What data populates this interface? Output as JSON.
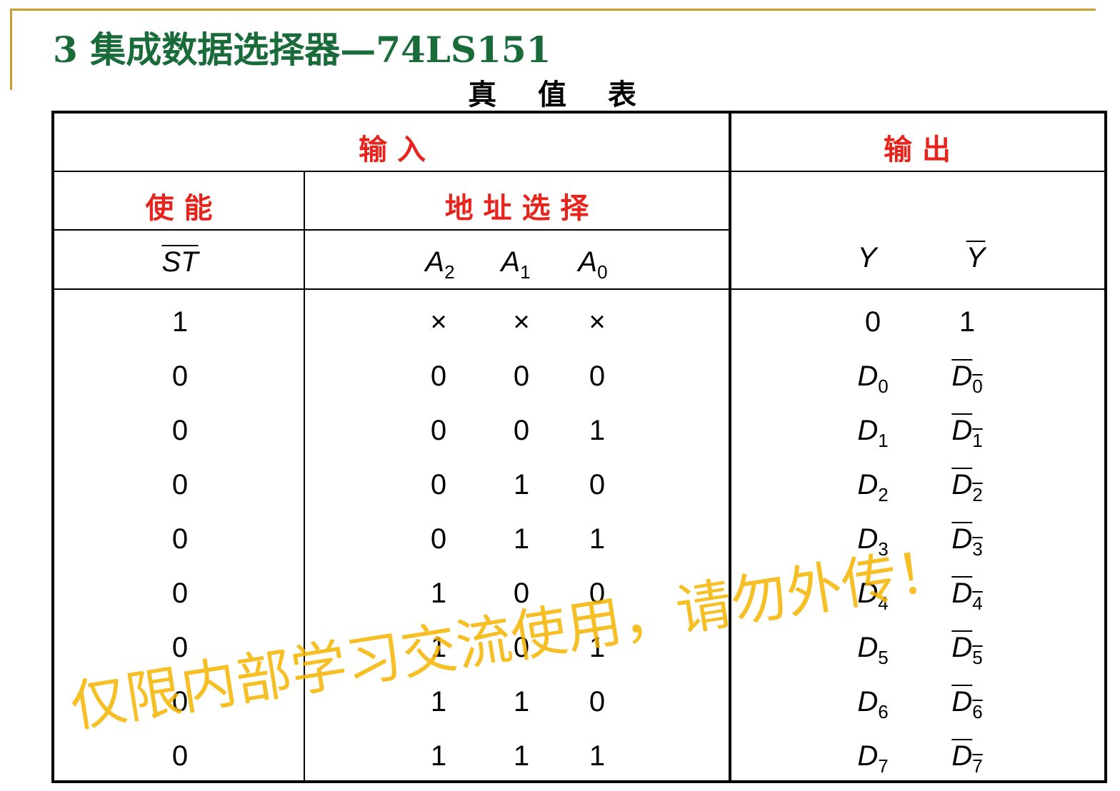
{
  "title": "3  集成数据选择器—74LS151",
  "caption": "真 值 表",
  "header": {
    "input": "输      入",
    "output": "输      出",
    "enable": "使 能",
    "address": "地 址 选 择"
  },
  "columns": {
    "st": "ST",
    "a2": "A",
    "a2_sub": "2",
    "a1": "A",
    "a1_sub": "1",
    "a0": "A",
    "a0_sub": "0",
    "y": "Y",
    "ybar": "Y"
  },
  "rows": [
    {
      "st": "1",
      "a2": "×",
      "a1": "×",
      "a0": "×",
      "y": "0",
      "y_sub": "",
      "yb": "1",
      "yb_sub": ""
    },
    {
      "st": "0",
      "a2": "0",
      "a1": "0",
      "a0": "0",
      "y": "D",
      "y_sub": "0",
      "yb": "D",
      "yb_sub": "0"
    },
    {
      "st": "0",
      "a2": "0",
      "a1": "0",
      "a0": "1",
      "y": "D",
      "y_sub": "1",
      "yb": "D",
      "yb_sub": "1"
    },
    {
      "st": "0",
      "a2": "0",
      "a1": "1",
      "a0": "0",
      "y": "D",
      "y_sub": "2",
      "yb": "D",
      "yb_sub": "2"
    },
    {
      "st": "0",
      "a2": "0",
      "a1": "1",
      "a0": "1",
      "y": "D",
      "y_sub": "3",
      "yb": "D",
      "yb_sub": "3"
    },
    {
      "st": "0",
      "a2": "1",
      "a1": "0",
      "a0": "0",
      "y": "D",
      "y_sub": "4",
      "yb": "D",
      "yb_sub": "4"
    },
    {
      "st": "0",
      "a2": "1",
      "a1": "0",
      "a0": "1",
      "y": "D",
      "y_sub": "5",
      "yb": "D",
      "yb_sub": "5"
    },
    {
      "st": "0",
      "a2": "1",
      "a1": "1",
      "a0": "0",
      "y": "D",
      "y_sub": "6",
      "yb": "D",
      "yb_sub": "6"
    },
    {
      "st": "0",
      "a2": "1",
      "a1": "1",
      "a0": "1",
      "y": "D",
      "y_sub": "7",
      "yb": "D",
      "yb_sub": "7"
    }
  ],
  "watermark": "仅限内部学习交流使用，请勿外传！",
  "colors": {
    "title": "#1a6b3a",
    "header": "#e8231c",
    "rule": "#c8a032",
    "watermark": "#f5b400"
  }
}
